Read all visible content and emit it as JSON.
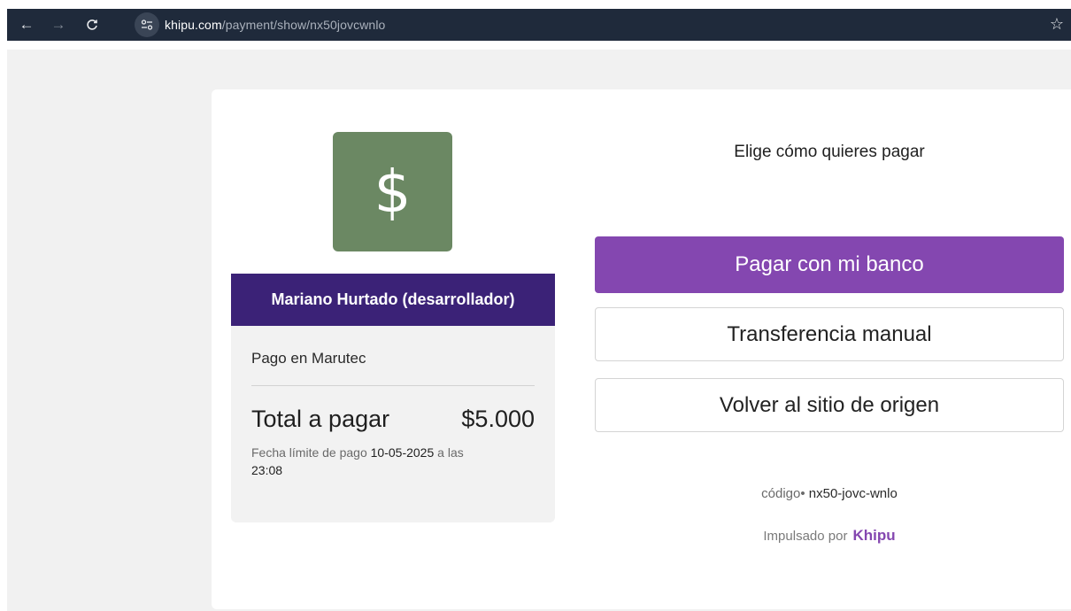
{
  "browser": {
    "url_host": "khipu.com",
    "url_path": "/payment/show/nx50jovcwnlo",
    "icons": {
      "back": "arrow-left-icon",
      "forward": "arrow-right-icon",
      "reload": "reload-icon",
      "site_info": "tune-icon",
      "bookmark": "star-icon"
    }
  },
  "merchant": {
    "logo_symbol": "$",
    "name": "Mariano Hurtado (desarrollador)",
    "subject": "Pago en Marutec",
    "total_label": "Total a pagar",
    "total_amount": "$5.000",
    "deadline_prefix": "Fecha límite de pago",
    "deadline_date": "10-05-2025",
    "deadline_mid": "a las",
    "deadline_time": "23:08"
  },
  "payment": {
    "title": "Elige cómo quieres pagar",
    "pay_bank_label": "Pagar con mi banco",
    "transfer_label": "Transferencia manual",
    "back_label": "Volver al sitio de origen",
    "code_label": "código•",
    "code_value": "nx50-jovc-wnlo",
    "powered_label": "Impulsado por",
    "brand": "Khipu"
  },
  "colors": {
    "primary": "#8447b0",
    "merchant_header": "#3b2277",
    "logo_bg": "#6b8863"
  }
}
